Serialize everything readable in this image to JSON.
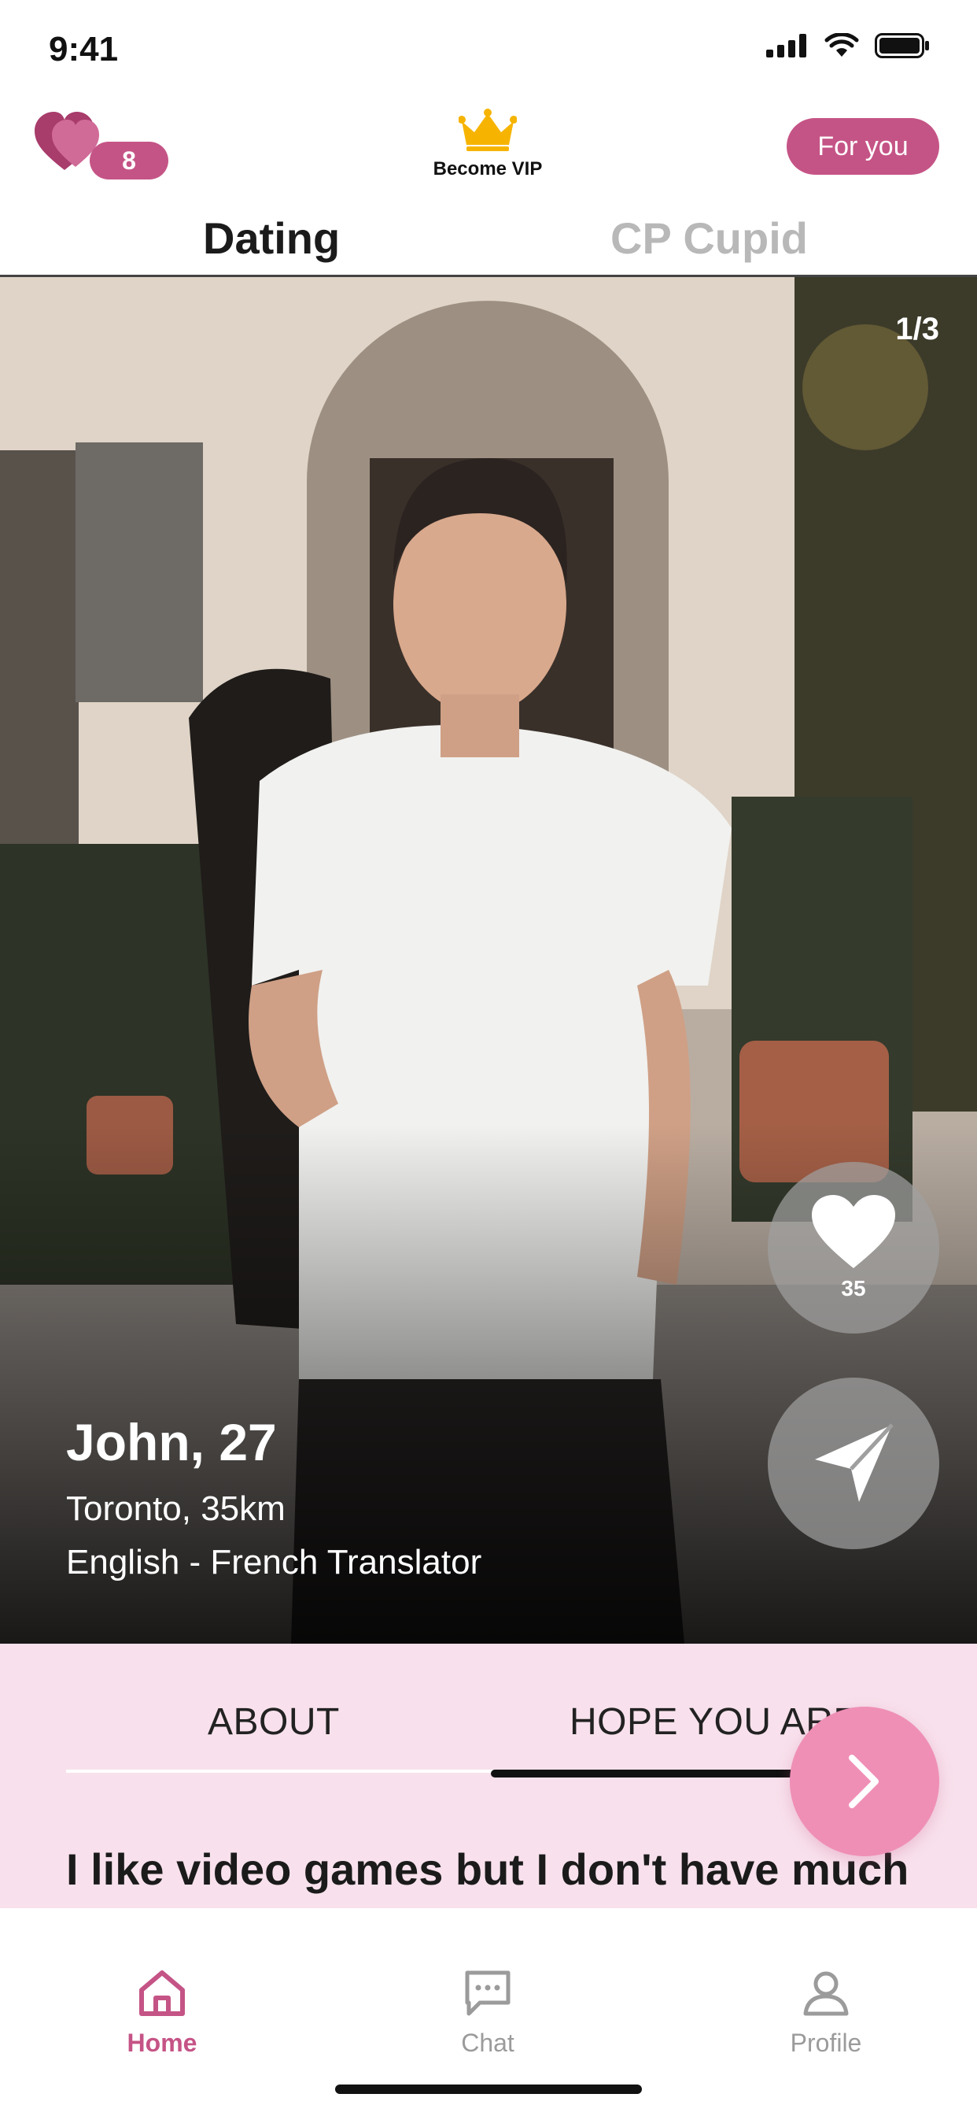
{
  "status_bar": {
    "time": "9:41"
  },
  "header": {
    "likes_count": "8",
    "vip_label": "Become VIP",
    "for_you_label": "For you"
  },
  "tabs": {
    "dating": "Dating",
    "cupid": "CP Cupid",
    "active": "Dating"
  },
  "profile": {
    "photo_counter": "1/3",
    "name_age": "John, 27",
    "location": "Toronto, 35km",
    "job": "English - French Translator",
    "like_count": "35"
  },
  "content_tabs": {
    "about": "ABOUT",
    "hope": "HOPE YOU ARE",
    "active": "HOPE YOU ARE"
  },
  "about_text": "I like video games but I don't have much",
  "nav": {
    "home": "Home",
    "chat": "Chat",
    "profile": "Profile",
    "active": "Home"
  },
  "colors": {
    "accent": "#c55486",
    "next_button": "#ef8fb6",
    "content_bg": "#f8e1ec",
    "vip_crown": "#f6b400"
  }
}
